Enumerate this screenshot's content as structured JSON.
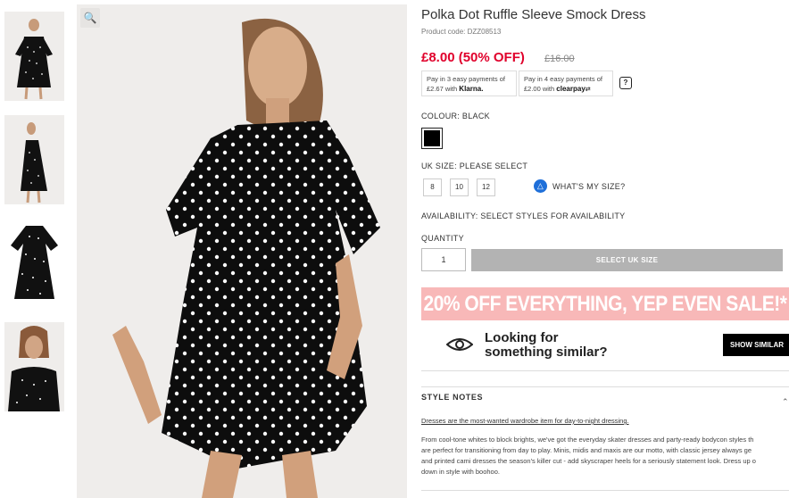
{
  "product": {
    "title": "Polka Dot Ruffle Sleeve Smock Dress",
    "code": "Product code: DZZ08513",
    "price": "£8.00 (50% OFF)",
    "was_price": "£16.00"
  },
  "payments": {
    "klarna_line1": "Pay in 3 easy payments of",
    "klarna_amount": "£2.67 with",
    "klarna_logo": "Klarna.",
    "clearpay_line1": "Pay in 4 easy payments of",
    "clearpay_amount": "£2.00 with",
    "clearpay_logo": "clearpay",
    "help": "?"
  },
  "colour": {
    "label": "COLOUR:",
    "value": "BLACK",
    "swatch_color": "#000000"
  },
  "size": {
    "label": "UK SIZE:",
    "value": "PLEASE SELECT",
    "options": [
      "8",
      "10",
      "12"
    ],
    "help_label": "WHAT'S MY SIZE?"
  },
  "availability": {
    "label": "AVAILABILITY:",
    "value": "SELECT STYLES FOR AVAILABILITY"
  },
  "quantity": {
    "label": "QUANTITY",
    "value": "1"
  },
  "add_button": "SELECT UK SIZE",
  "promo": "20% OFF EVERYTHING, YEP EVEN SALE!*",
  "similar": {
    "line1": "Looking for",
    "line2": "something similar?",
    "button": "SHOW SIMILAR"
  },
  "notes": {
    "heading": "STYLE NOTES",
    "subheading": "Dresses are the most-wanted wardrobe item for day-to-night dressing.",
    "body_lines": [
      "From cool-tone whites to block brights, we've got the everyday skater dresses and party-ready bodycon styles th",
      "are perfect for transitioning from day to play. Minis, midis and maxis are our motto, with classic jersey always ge",
      "and printed cami dresses the season's killer cut - add skyscraper heels for a seriously statement look. Dress up o",
      "down in style with boohoo."
    ]
  },
  "colors": {
    "price_red": "#e0002b",
    "promo_pink": "#f8b8b8",
    "button_grey": "#b3b3b3",
    "size_icon_blue": "#1e6fd9"
  }
}
